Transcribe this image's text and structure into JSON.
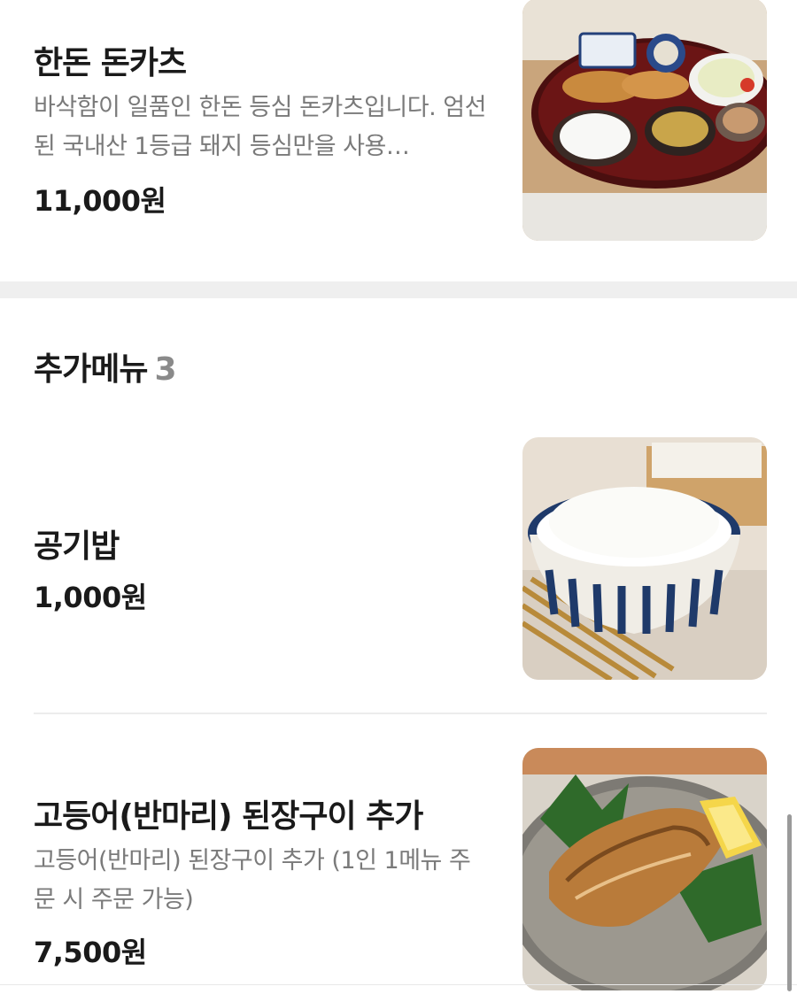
{
  "menu_items": [
    {
      "title": "한돈 돈카츠",
      "description": "바삭함이 일품인 한돈 등심 돈카츠입니다. 엄선된 국내산 1등급 돼지 등심만을 사용…",
      "price": "11,000원",
      "image": "tonkatsu-set-image"
    }
  ],
  "section": {
    "title": "추가메뉴",
    "count": "3"
  },
  "extra_items": [
    {
      "title": "공기밥",
      "price": "1,000원",
      "image": "rice-bowl-image"
    },
    {
      "title": "고등어(반마리) 된장구이 추가",
      "description": "고등어(반마리) 된장구이 추가 (1인 1메뉴 주문 시 주문 가능)",
      "price": "7,500원",
      "image": "grilled-mackerel-image"
    }
  ],
  "colors": {
    "section_gap": "#efefef",
    "secondary_text": "#7a7a7a",
    "primary_text": "#1a1a1a"
  }
}
